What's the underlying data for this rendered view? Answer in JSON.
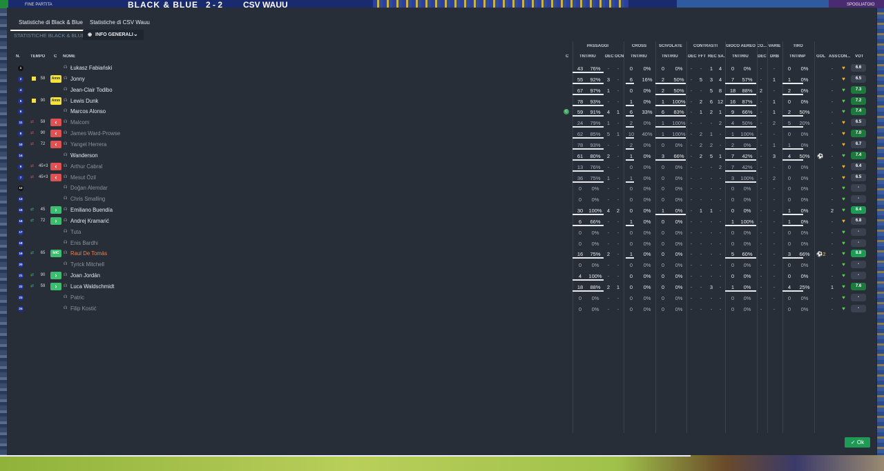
{
  "header": {
    "result_label": "FINE PARTITA",
    "home_team": "BLACK & BLUE",
    "score": "2 - 2",
    "away_team": "CSV WAUU",
    "player_label": "SPOGLIATOIO"
  },
  "tabs": [
    "Statistiche di Black & Blue",
    "Statistiche di CSV Wauu"
  ],
  "subtitle": "STATISTICHE BLACK & BLUE",
  "dropdown_label": "INFO GENERALI",
  "group_headers": [
    "PASSAGGI",
    "CROSS",
    "SCIVOLATE",
    "CONTRASTI",
    "GIOCO AEREO",
    "CO...",
    "VARIE",
    "TIRO"
  ],
  "column_headers": [
    "N.",
    "TEMPO",
    "C",
    "NOME",
    "C",
    "TNT/RIU",
    "DEC",
    "OCN",
    "TNT/RIU",
    "TNT/RIU",
    "DEC",
    "FFT",
    "REC SA...",
    "TNT/RIU",
    "DEC",
    "DRB",
    "TNT/INP",
    "GOL",
    "ASS",
    "CON...",
    "VOT"
  ],
  "ok_label": "Ok",
  "colors": {
    "panel": "#272e38",
    "accent_green": "#1f9a55",
    "sub_red": "#e05252",
    "sub_green": "#3bbf6e",
    "yellow": "#f5e23a"
  },
  "rows": [
    {
      "num": "1",
      "kit": "goalkeeper",
      "min": "",
      "badge": "",
      "name": "Łukasz Fabiański",
      "pass": "43",
      "pass_pct": "76%",
      "pass_dec": "-",
      "pass_ocn": "-",
      "cross": "0",
      "cross_pct": "0%",
      "tack": "0",
      "tack_pct": "0%",
      "con_dec": "-",
      "con_fft": "-",
      "con_rec": "1",
      "con_sa": "4",
      "aer": "0",
      "aer_pct": "0%",
      "co_dec": "-",
      "drb": "-",
      "shot": "0",
      "shot_pct": "0%",
      "gol": "",
      "ass": "-",
      "vote": "6.6",
      "vote_color": "#3a4250"
    },
    {
      "num": "2",
      "kit": "outfield",
      "min": "58",
      "badge": "Amm",
      "name": "Jonny",
      "pass": "55",
      "pass_pct": "92%",
      "pass_dec": "3",
      "pass_ocn": "-",
      "cross": "6",
      "cross_pct": "16%",
      "tack": "2",
      "tack_pct": "50%",
      "con_dec": "-",
      "con_fft": "5",
      "con_rec": "3",
      "con_sa": "4",
      "aer": "7",
      "aer_pct": "57%",
      "co_dec": "-",
      "drb": "1",
      "shot": "1",
      "shot_pct": "0%",
      "gol": "",
      "ass": "-",
      "vote": "6.5",
      "vote_color": "#3a4250"
    },
    {
      "num": "4",
      "kit": "outfield",
      "min": "",
      "badge": "",
      "name": "Jean-Clair Todibo",
      "pass": "67",
      "pass_pct": "97%",
      "pass_dec": "1",
      "pass_ocn": "-",
      "cross": "0",
      "cross_pct": "0%",
      "tack": "2",
      "tack_pct": "50%",
      "con_dec": "-",
      "con_fft": "-",
      "con_rec": "5",
      "con_sa": "8",
      "aer": "18",
      "aer_pct": "88%",
      "co_dec": "2",
      "drb": "-",
      "shot": "2",
      "shot_pct": "0%",
      "gol": "",
      "ass": "-",
      "vote": "7.3",
      "vote_color": "#1e7a3c"
    },
    {
      "num": "5",
      "kit": "outfield",
      "min": "90",
      "badge": "Amm",
      "name": "Lewis Dunk",
      "pass": "78",
      "pass_pct": "93%",
      "pass_dec": "-",
      "pass_ocn": "-",
      "cross": "1",
      "cross_pct": "0%",
      "tack": "1",
      "tack_pct": "100%",
      "con_dec": "-",
      "con_fft": "2",
      "con_rec": "6",
      "con_sa": "12",
      "aer": "16",
      "aer_pct": "87%",
      "co_dec": "-",
      "drb": "1",
      "shot": "0",
      "shot_pct": "0%",
      "gol": "",
      "ass": "-",
      "vote": "7.2",
      "vote_color": "#1e7a3c"
    },
    {
      "num": "6",
      "kit": "outfield",
      "min": "",
      "badge": "",
      "name": "Marcos Alonso",
      "pass": "59",
      "pass_pct": "91%",
      "pass_dec": "4",
      "pass_ocn": "1",
      "cross": "6",
      "cross_pct": "33%",
      "tack": "6",
      "tack_pct": "83%",
      "con_dec": "-",
      "con_fft": "1",
      "con_rec": "2",
      "con_sa": "1",
      "aer": "9",
      "aer_pct": "66%",
      "co_dec": "-",
      "drb": "1",
      "shot": "2",
      "shot_pct": "50%",
      "gol": "",
      "ass": "-",
      "vote": "7.4",
      "vote_color": "#1e7a3c",
      "captain": "C"
    },
    {
      "num": "11",
      "kit": "outfield",
      "min": "59",
      "badge": "out",
      "name": "Malcom",
      "pass": "24",
      "pass_pct": "79%",
      "pass_dec": "1",
      "pass_ocn": "-",
      "cross": "2",
      "cross_pct": "0%",
      "tack": "1",
      "tack_pct": "100%",
      "con_dec": "-",
      "con_fft": "-",
      "con_rec": "-",
      "con_sa": "2",
      "aer": "4",
      "aer_pct": "50%",
      "co_dec": "-",
      "drb": "2",
      "shot": "5",
      "shot_pct": "20%",
      "gol": "",
      "ass": "-",
      "vote": "6.5",
      "vote_color": "#3a4250"
    },
    {
      "num": "8",
      "kit": "outfield",
      "min": "90",
      "badge": "out",
      "name": "James Ward-Prowse",
      "pass": "62",
      "pass_pct": "85%",
      "pass_dec": "5",
      "pass_ocn": "1",
      "cross": "10",
      "cross_pct": "40%",
      "tack": "1",
      "tack_pct": "100%",
      "con_dec": "-",
      "con_fft": "2",
      "con_rec": "1",
      "con_sa": "-",
      "aer": "1",
      "aer_pct": "100%",
      "co_dec": "-",
      "drb": "-",
      "shot": "0",
      "shot_pct": "0%",
      "gol": "",
      "ass": "-",
      "vote": "7.0",
      "vote_color": "#1e7a3c"
    },
    {
      "num": "10",
      "kit": "outfield",
      "min": "72",
      "badge": "out",
      "name": "Yangel Herrera",
      "pass": "78",
      "pass_pct": "93%",
      "pass_dec": "-",
      "pass_ocn": "-",
      "cross": "2",
      "cross_pct": "0%",
      "tack": "0",
      "tack_pct": "0%",
      "con_dec": "-",
      "con_fft": "2",
      "con_rec": "2",
      "con_sa": "-",
      "aer": "2",
      "aer_pct": "0%",
      "co_dec": "-",
      "drb": "1",
      "shot": "1",
      "shot_pct": "0%",
      "gol": "",
      "ass": "-",
      "vote": "6.7",
      "vote_color": "#3a4250"
    },
    {
      "num": "14",
      "kit": "outfield",
      "min": "",
      "badge": "",
      "name": "Wanderson",
      "pass": "61",
      "pass_pct": "80%",
      "pass_dec": "2",
      "pass_ocn": "-",
      "cross": "1",
      "cross_pct": "0%",
      "tack": "3",
      "tack_pct": "66%",
      "con_dec": "-",
      "con_fft": "2",
      "con_rec": "5",
      "con_sa": "1",
      "aer": "7",
      "aer_pct": "42%",
      "co_dec": "-",
      "drb": "3",
      "shot": "4",
      "shot_pct": "50%",
      "gol": "⚽",
      "ass": "-",
      "vote": "7.4",
      "vote_color": "#1e7a3c"
    },
    {
      "num": "9",
      "kit": "outfield",
      "min": "45+3",
      "badge": "out",
      "name": "Arthur Cabral",
      "pass": "13",
      "pass_pct": "76%",
      "pass_dec": "-",
      "pass_ocn": "-",
      "cross": "0",
      "cross_pct": "0%",
      "tack": "0",
      "tack_pct": "0%",
      "con_dec": "-",
      "con_fft": "-",
      "con_rec": "-",
      "con_sa": "2",
      "aer": "7",
      "aer_pct": "42%",
      "co_dec": "-",
      "drb": "-",
      "shot": "0",
      "shot_pct": "0%",
      "gol": "",
      "ass": "-",
      "vote": "6.4",
      "vote_color": "#3a4250"
    },
    {
      "num": "7",
      "kit": "outfield",
      "min": "45+3",
      "badge": "out",
      "name": "Mesut Özil",
      "pass": "36",
      "pass_pct": "75%",
      "pass_dec": "1",
      "pass_ocn": "-",
      "cross": "1",
      "cross_pct": "0%",
      "tack": "0",
      "tack_pct": "0%",
      "con_dec": "-",
      "con_fft": "-",
      "con_rec": "-",
      "con_sa": "-",
      "aer": "3",
      "aer_pct": "100%",
      "co_dec": "-",
      "drb": "2",
      "shot": "0",
      "shot_pct": "0%",
      "gol": "",
      "ass": "-",
      "vote": "6.5",
      "vote_color": "#3a4250"
    },
    {
      "num": "12",
      "kit": "goalkeeper",
      "min": "",
      "badge": "",
      "name": "Doğan Alemdar",
      "pass": "0",
      "pass_pct": "0%",
      "pass_dec": "-",
      "pass_ocn": "-",
      "cross": "0",
      "cross_pct": "0%",
      "tack": "0",
      "tack_pct": "0%",
      "con_dec": "-",
      "con_fft": "-",
      "con_rec": "-",
      "con_sa": "-",
      "aer": "0",
      "aer_pct": "0%",
      "co_dec": "-",
      "drb": "-",
      "shot": "0",
      "shot_pct": "0%",
      "gol": "",
      "ass": "-",
      "vote": "-",
      "vote_color": "#3a4250",
      "unused": true
    },
    {
      "num": "13",
      "kit": "outfield",
      "min": "",
      "badge": "",
      "name": "Chris Smalling",
      "pass": "0",
      "pass_pct": "0%",
      "pass_dec": "-",
      "pass_ocn": "-",
      "cross": "0",
      "cross_pct": "0%",
      "tack": "0",
      "tack_pct": "0%",
      "con_dec": "-",
      "con_fft": "-",
      "con_rec": "-",
      "con_sa": "-",
      "aer": "0",
      "aer_pct": "0%",
      "co_dec": "-",
      "drb": "-",
      "shot": "0",
      "shot_pct": "0%",
      "gol": "",
      "ass": "-",
      "vote": "-",
      "vote_color": "#3a4250",
      "unused": true
    },
    {
      "num": "15",
      "kit": "outfield",
      "min": "45",
      "badge": "in",
      "name": "Emiliano Buendía",
      "pass": "30",
      "pass_pct": "100%",
      "pass_dec": "4",
      "pass_ocn": "2",
      "cross": "0",
      "cross_pct": "0%",
      "tack": "1",
      "tack_pct": "0%",
      "con_dec": "-",
      "con_fft": "1",
      "con_rec": "1",
      "con_sa": "-",
      "aer": "0",
      "aer_pct": "0%",
      "co_dec": "-",
      "drb": "-",
      "shot": "1",
      "shot_pct": "0%",
      "gol": "",
      "ass": "2",
      "vote": "8.4",
      "vote_color": "#1f9a55"
    },
    {
      "num": "16",
      "kit": "outfield",
      "min": "72",
      "badge": "in",
      "name": "Andrej Kramarić",
      "pass": "6",
      "pass_pct": "66%",
      "pass_dec": "-",
      "pass_ocn": "-",
      "cross": "1",
      "cross_pct": "0%",
      "tack": "0",
      "tack_pct": "0%",
      "con_dec": "-",
      "con_fft": "-",
      "con_rec": "-",
      "con_sa": "-",
      "aer": "1",
      "aer_pct": "100%",
      "co_dec": "-",
      "drb": "-",
      "shot": "1",
      "shot_pct": "0%",
      "gol": "",
      "ass": "-",
      "vote": "6.8",
      "vote_color": "#3a4250"
    },
    {
      "num": "17",
      "kit": "outfield",
      "min": "",
      "badge": "",
      "name": "Tuta",
      "pass": "0",
      "pass_pct": "0%",
      "pass_dec": "-",
      "pass_ocn": "-",
      "cross": "0",
      "cross_pct": "0%",
      "tack": "0",
      "tack_pct": "0%",
      "con_dec": "-",
      "con_fft": "-",
      "con_rec": "-",
      "con_sa": "-",
      "aer": "0",
      "aer_pct": "0%",
      "co_dec": "-",
      "drb": "-",
      "shot": "0",
      "shot_pct": "0%",
      "gol": "",
      "ass": "-",
      "vote": "-",
      "vote_color": "#3a4250",
      "unused": true
    },
    {
      "num": "18",
      "kit": "outfield",
      "min": "",
      "badge": "",
      "name": "Enis Bardhi",
      "pass": "0",
      "pass_pct": "0%",
      "pass_dec": "-",
      "pass_ocn": "-",
      "cross": "0",
      "cross_pct": "0%",
      "tack": "0",
      "tack_pct": "0%",
      "con_dec": "-",
      "con_fft": "-",
      "con_rec": "-",
      "con_sa": "-",
      "aer": "0",
      "aer_pct": "0%",
      "co_dec": "-",
      "drb": "-",
      "shot": "0",
      "shot_pct": "0%",
      "gol": "",
      "ass": "-",
      "vote": "-",
      "vote_color": "#3a4250",
      "unused": true
    },
    {
      "num": "19",
      "kit": "outfield",
      "min": "65",
      "badge": "MiC",
      "name": "Raul De Tomás",
      "pass": "16",
      "pass_pct": "75%",
      "pass_dec": "2",
      "pass_ocn": "-",
      "cross": "1",
      "cross_pct": "0%",
      "tack": "0",
      "tack_pct": "0%",
      "con_dec": "-",
      "con_fft": "-",
      "con_rec": "-",
      "con_sa": "-",
      "aer": "5",
      "aer_pct": "60%",
      "co_dec": "-",
      "drb": "-",
      "shot": "3",
      "shot_pct": "66%",
      "gol": "⚽2",
      "ass": "-",
      "vote": "8.8",
      "vote_color": "#1f9a55",
      "highlight": true
    },
    {
      "num": "20",
      "kit": "outfield",
      "min": "",
      "badge": "",
      "name": "Tyrick Mitchell",
      "pass": "0",
      "pass_pct": "0%",
      "pass_dec": "-",
      "pass_ocn": "-",
      "cross": "0",
      "cross_pct": "0%",
      "tack": "0",
      "tack_pct": "0%",
      "con_dec": "-",
      "con_fft": "-",
      "con_rec": "-",
      "con_sa": "-",
      "aer": "0",
      "aer_pct": "0%",
      "co_dec": "-",
      "drb": "-",
      "shot": "0",
      "shot_pct": "0%",
      "gol": "",
      "ass": "-",
      "vote": "-",
      "vote_color": "#3a4250",
      "unused": true
    },
    {
      "num": "21",
      "kit": "outfield",
      "min": "90",
      "badge": "in",
      "name": "Joan Jordán",
      "pass": "4",
      "pass_pct": "100%",
      "pass_dec": "-",
      "pass_ocn": "-",
      "cross": "0",
      "cross_pct": "0%",
      "tack": "0",
      "tack_pct": "0%",
      "con_dec": "-",
      "con_fft": "-",
      "con_rec": "-",
      "con_sa": "-",
      "aer": "0",
      "aer_pct": "0%",
      "co_dec": "-",
      "drb": "-",
      "shot": "0",
      "shot_pct": "0%",
      "gol": "",
      "ass": "-",
      "vote": "-",
      "vote_color": "#3a4250"
    },
    {
      "num": "22",
      "kit": "outfield",
      "min": "59",
      "badge": "in",
      "name": "Luca Waldschmidt",
      "pass": "18",
      "pass_pct": "88%",
      "pass_dec": "2",
      "pass_ocn": "1",
      "cross": "0",
      "cross_pct": "0%",
      "tack": "0",
      "tack_pct": "0%",
      "con_dec": "-",
      "con_fft": "-",
      "con_rec": "3",
      "con_sa": "-",
      "aer": "1",
      "aer_pct": "0%",
      "co_dec": "-",
      "drb": "-",
      "shot": "4",
      "shot_pct": "25%",
      "gol": "",
      "ass": "1",
      "vote": "7.6",
      "vote_color": "#1e7a3c"
    },
    {
      "num": "23",
      "kit": "outfield",
      "min": "",
      "badge": "",
      "name": "Patric",
      "pass": "0",
      "pass_pct": "0%",
      "pass_dec": "-",
      "pass_ocn": "-",
      "cross": "0",
      "cross_pct": "0%",
      "tack": "0",
      "tack_pct": "0%",
      "con_dec": "-",
      "con_fft": "-",
      "con_rec": "-",
      "con_sa": "-",
      "aer": "0",
      "aer_pct": "0%",
      "co_dec": "-",
      "drb": "-",
      "shot": "0",
      "shot_pct": "0%",
      "gol": "",
      "ass": "-",
      "vote": "-",
      "vote_color": "#3a4250",
      "unused": true
    },
    {
      "num": "24",
      "kit": "outfield",
      "min": "",
      "badge": "",
      "name": "Filip Kostić",
      "pass": "0",
      "pass_pct": "0%",
      "pass_dec": "-",
      "pass_ocn": "-",
      "cross": "0",
      "cross_pct": "0%",
      "tack": "0",
      "tack_pct": "0%",
      "con_dec": "-",
      "con_fft": "-",
      "con_rec": "-",
      "con_sa": "-",
      "aer": "0",
      "aer_pct": "0%",
      "co_dec": "-",
      "drb": "-",
      "shot": "0",
      "shot_pct": "0%",
      "gol": "",
      "ass": "-",
      "vote": "-",
      "vote_color": "#3a4250",
      "unused": true
    }
  ]
}
